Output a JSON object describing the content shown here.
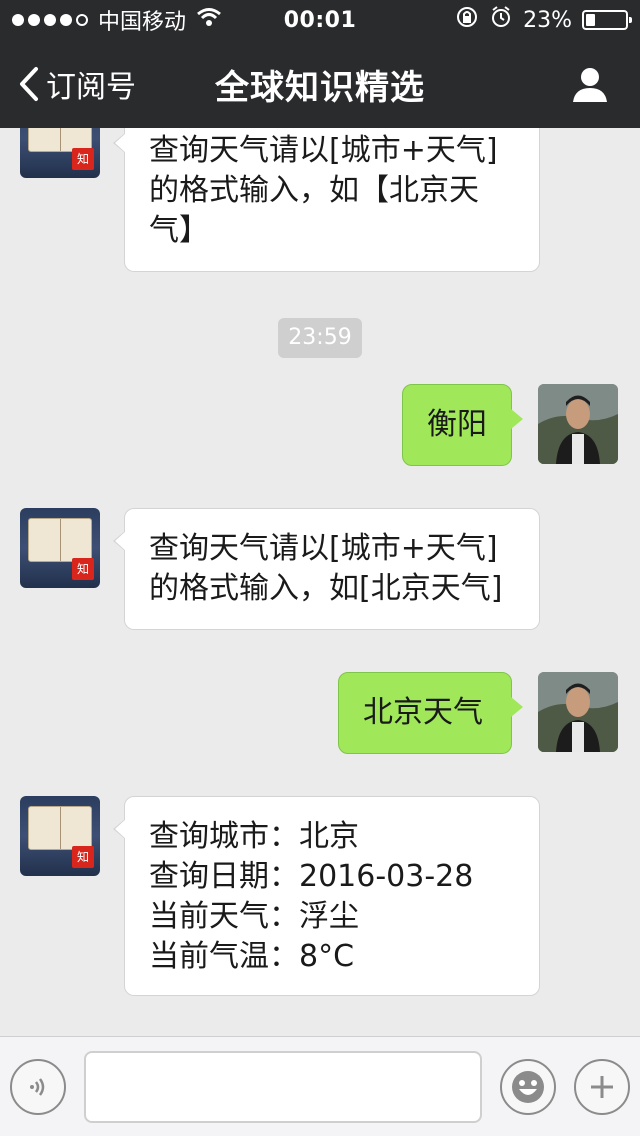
{
  "status": {
    "carrier": "中国移动",
    "time": "00:01",
    "battery": "23%"
  },
  "nav": {
    "back_label": "订阅号",
    "title": "全球知识精选"
  },
  "icons": {
    "back": "chevron-left-icon",
    "profile": "user-icon",
    "voice": "voice-icon",
    "emoji": "emoji-icon",
    "add": "plus-icon",
    "wifi": "wifi-icon",
    "lock": "rotation-lock-icon",
    "alarm": "alarm-icon",
    "battery": "battery-icon"
  },
  "messages": [
    {
      "side": "left",
      "lines": [
        "查询天气请以[城市+天气]",
        "的格式输入，如【北京天",
        "气】"
      ]
    },
    {
      "timestamp": "23:59"
    },
    {
      "side": "right",
      "text": "衡阳"
    },
    {
      "side": "left",
      "lines": [
        "查询天气请以[城市+天气]",
        "的格式输入，如[北京天气]"
      ]
    },
    {
      "side": "right",
      "text": "北京天气"
    },
    {
      "side": "left",
      "lines": [
        "查询城市：北京",
        "查询日期：2016-03-28",
        "当前天气：浮尘",
        "当前气温：8°C"
      ]
    }
  ],
  "avatar_bot_label": "知",
  "colors": {
    "bar": "#2a2b2d",
    "bubble_right": "#a0e75a",
    "bubble_left": "#ffffff",
    "chat_bg": "#ebebeb"
  }
}
